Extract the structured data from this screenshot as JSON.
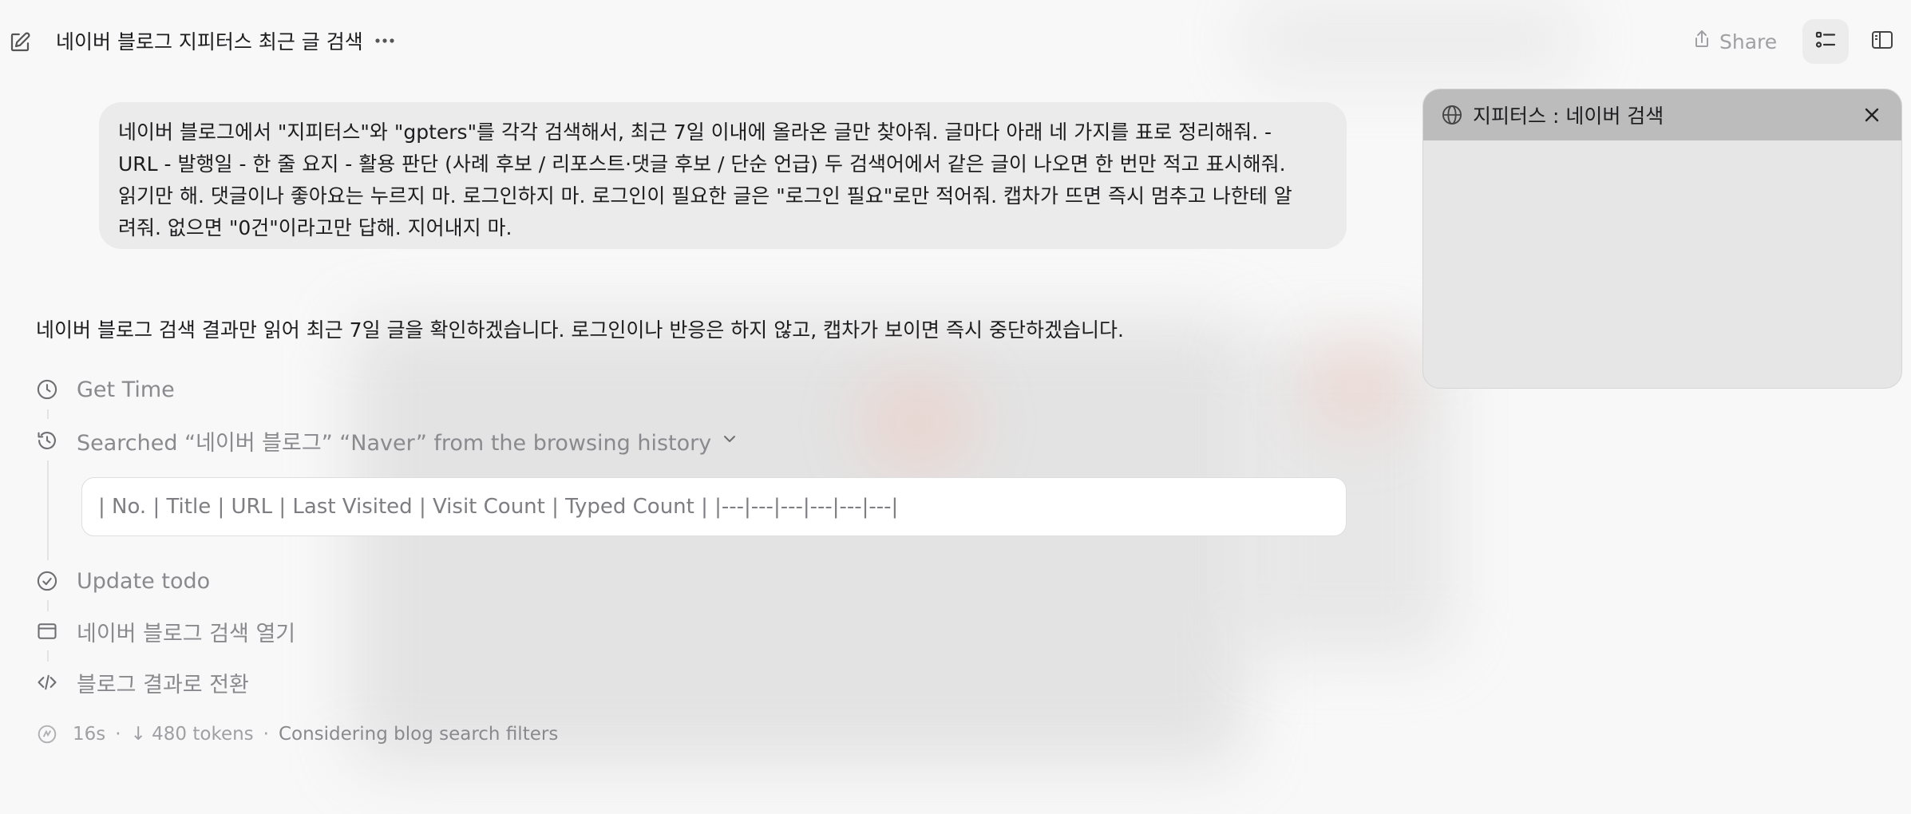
{
  "header": {
    "title": "네이버 블로그 지피터스 최근 글 검색",
    "share_label": "Share"
  },
  "user_message": {
    "lines": [
      "네이버 블로그에서 \"지피터스\"와 \"gpters\"를 각각 검색해서, 최근 7일 이내에 올라온 글만 찾아줘. 글마다 아래 네 가지를 표로 정리해줘. -",
      "URL - 발행일 - 한 줄 요지 - 활용 판단 (사례 후보 / 리포스트·댓글 후보 / 단순 언급) 두 검색어에서 같은 글이 나오면 한 번만 적고 표시해줘.",
      "읽기만 해. 댓글이나 좋아요는 누르지 마. 로그인하지 마. 로그인이 필요한 글은 \"로그인 필요\"로만 적어줘. 캡차가 뜨면 즉시 멈추고 나한테 알",
      "려줘. 없으면 \"0건\"이라고만 답해. 지어내지 마."
    ]
  },
  "assistant": {
    "text": "네이버 블로그 검색 결과만 읽어 최근 7일 글을 확인하겠습니다. 로그인이나 반응은 하지 않고, 캡차가 보이면 즉시 중단하겠습니다."
  },
  "steps": {
    "get_time": "Get Time",
    "search_history": "Searched “네이버 블로그” “Naver” from the browsing history",
    "search_result": "| No. | Title | URL | Last Visited | Visit Count | Typed Count | |---|---|---|---|---|---|",
    "update_todo": "Update todo",
    "open_search": "네이버 블로그 검색 열기",
    "switch_results": "블로그 결과로 전환"
  },
  "status": {
    "time": "16s",
    "tokens": "↓ 480 tokens",
    "activity": "Considering blog search filters"
  },
  "browser_panel": {
    "tab_title": "지피터스 : 네이버 검색"
  }
}
